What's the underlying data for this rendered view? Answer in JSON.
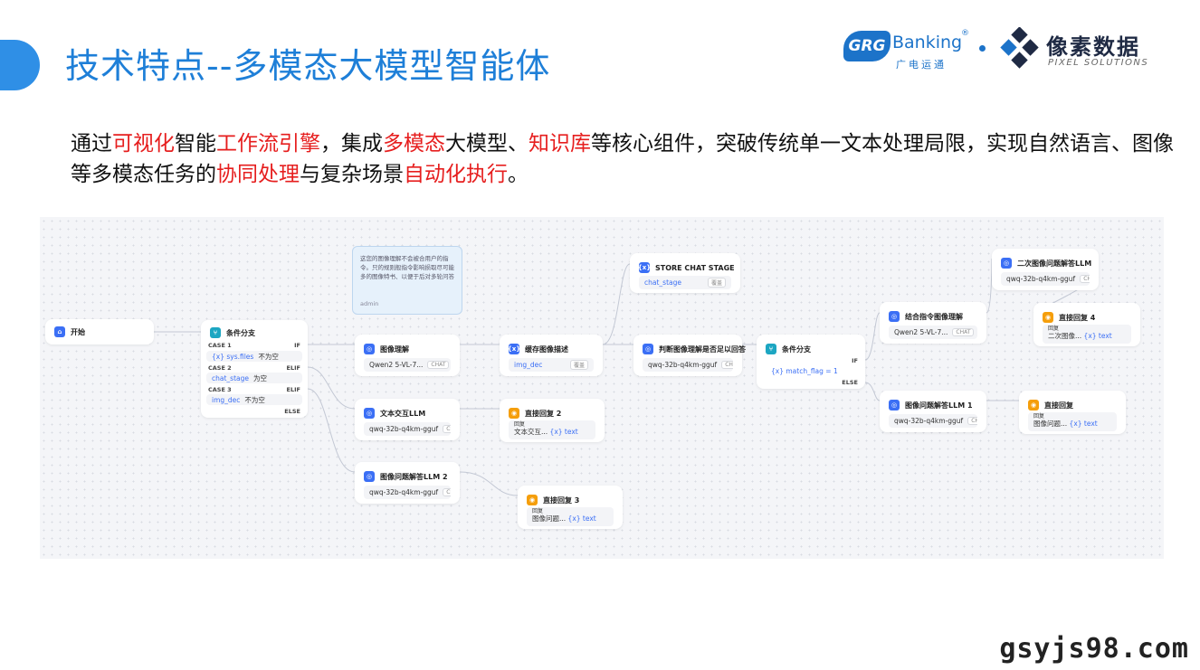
{
  "title": "技术特点--多模态大模型智能体",
  "brand": {
    "grg": "GRG",
    "banking": "Banking",
    "reg": "®",
    "guangdian": "广电运通",
    "pixel_cn": "像素数据",
    "pixel_en": "PIXEL SOLUTIONS"
  },
  "description": {
    "p1": "通过",
    "h1": "可视化",
    "p2": "智能",
    "h2": "工作流引擎",
    "p3": "，集成",
    "h3": "多模态",
    "p4": "大模型、",
    "h4": "知识库",
    "p5": "等核心组件，突破传统单一文本处理局限，实现自然语言、图像等多模态任务的",
    "h5": "协同处理",
    "p6": "与复杂场景",
    "h6": "自动化执行",
    "p7": "。"
  },
  "colors": {
    "accent": "#1e7fd8",
    "highlight": "#e61e1e",
    "node_blue": "#3b6ff5",
    "node_orange": "#f59e0b"
  },
  "workflow": {
    "start": {
      "label": "开始"
    },
    "branch1": {
      "title": "条件分支",
      "case1": "CASE 1",
      "case1_if": "IF",
      "case1_cond_var": "{x} sys.files",
      "case1_cond_op": "不为空",
      "case2": "CASE 2",
      "case2_if": "ELIF",
      "case2_cond_var": "chat_stage",
      "case2_cond_op": "为空",
      "case3": "CASE 3",
      "case3_if": "ELIF",
      "case3_cond_var": "img_dec",
      "case3_cond_op": "不为空",
      "else": "ELSE"
    },
    "note": {
      "text": "这您的图像理解不会被合用户的指令。只的规则般指令影响损取尽可能多的图像特书、以便于后对多轮问答",
      "author": "admin"
    },
    "image_understand": {
      "title": "图像理解",
      "model": "Qwen2 5-VL-7...",
      "tag": "CHAT"
    },
    "cache_desc": {
      "title": "缓存图像描述",
      "var": "img_dec",
      "tag": "覆盖"
    },
    "store_chat": {
      "title": "STORE CHAT STAGE",
      "var": "chat_stage",
      "tag": "覆盖"
    },
    "judge": {
      "title": "判断图像理解是否足以回答",
      "model": "qwq-32b-q4km-gguf",
      "tag": "CHAT"
    },
    "branch2": {
      "title": "条件分支",
      "cond": "{x} match_flag = 1",
      "if": "IF",
      "else": "ELSE"
    },
    "text_llm": {
      "title": "文本交互LLM",
      "model": "qwq-32b-q4km-gguf",
      "tag": "CHAT"
    },
    "reply2": {
      "title": "直接回复 2",
      "label": "回复",
      "field": "文本交互...",
      "var": "{x} text"
    },
    "img_qa_llm2": {
      "title": "图像问题解答LLM 2",
      "model": "qwq-32b-q4km-gguf",
      "tag": "CHAT"
    },
    "reply3": {
      "title": "直接回复 3",
      "label": "回复",
      "field": "图像问题...",
      "var": "{x} text"
    },
    "combine": {
      "title": "结合指令图像理解",
      "model": "Qwen2 5-VL-7...",
      "tag": "CHAT"
    },
    "second_qa": {
      "title": "二次图像问题解答LLM",
      "model": "qwq-32b-q4km-gguf",
      "tag": "CHAT"
    },
    "reply4": {
      "title": "直接回复 4",
      "label": "回复",
      "field": "二次图像...",
      "var": "{x} text"
    },
    "img_qa_llm1": {
      "title": "图像问题解答LLM 1",
      "model": "qwq-32b-q4km-gguf",
      "tag": "CHAT"
    },
    "reply1": {
      "title": "直接回复",
      "label": "回复",
      "field": "图像问题...",
      "var": "{x} text"
    }
  },
  "watermark": "gsyjs98.com"
}
